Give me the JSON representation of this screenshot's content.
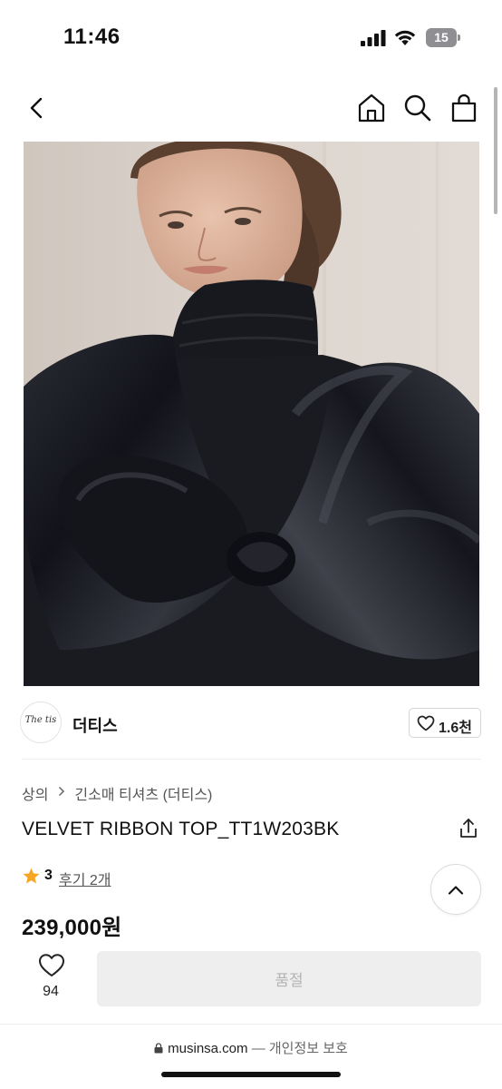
{
  "status_bar": {
    "time": "11:46",
    "battery_level": "15",
    "icons": [
      "cellular-signal-icon",
      "wifi-icon",
      "battery-icon"
    ]
  },
  "nav": {
    "icons": [
      "back-chevron-icon",
      "home-icon",
      "search-icon",
      "shopping-bag-icon"
    ]
  },
  "product": {
    "image_icon": "product-photo",
    "brand": {
      "logo_text": "The tis",
      "name": "더티스",
      "likes": "1.6천"
    },
    "breadcrumb": {
      "category": "상의",
      "subcategory": "긴소매 티셔츠 (더티스)"
    },
    "title": "VELVET RIBBON TOP_TT1W203BK",
    "rating": {
      "value": "3",
      "reviews": "후기 2개"
    },
    "price": "239,000원"
  },
  "bottom_bar": {
    "likes": "94",
    "purchase_button": "품절"
  },
  "browser": {
    "domain": "musinsa.com",
    "separator": "—",
    "privacy": "개인정보 보호"
  },
  "colors": {
    "accent_star": "#f5a623",
    "soldout_bg": "#eeeeee",
    "soldout_text": "#b4b4b4"
  }
}
